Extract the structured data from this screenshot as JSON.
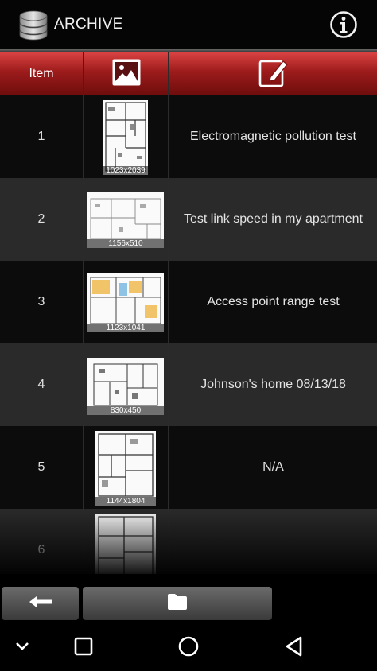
{
  "app_bar": {
    "title": "ARCHIVE",
    "db_icon": "database-icon",
    "info_icon": "info-icon"
  },
  "table": {
    "headers": {
      "item": "Item",
      "image_icon": "image-icon",
      "edit_icon": "edit-icon"
    },
    "rows": [
      {
        "item": "1",
        "dim": "1023x2039",
        "description": "Electromagnetic pollution test"
      },
      {
        "item": "2",
        "dim": "1156x510",
        "description": "Test link speed in my apartment"
      },
      {
        "item": "3",
        "dim": "1123x1041",
        "description": "Access point range test"
      },
      {
        "item": "4",
        "dim": "830x450",
        "description": "Johnson's home 08/13/18"
      },
      {
        "item": "5",
        "dim": "1144x1804",
        "description": "N/A"
      },
      {
        "item": "6",
        "dim": "",
        "description": ""
      }
    ]
  },
  "bottom_buttons": {
    "back_icon": "arrow-left-icon",
    "folder_icon": "folder-icon"
  },
  "nav_bar": {
    "icons": [
      "chevron-down-icon",
      "recents-icon",
      "home-icon",
      "back-triangle-icon"
    ]
  },
  "colors": {
    "header_red": "#a51f1f",
    "row_dark": "#0c0c0c",
    "row_light": "#2a2a2a"
  }
}
